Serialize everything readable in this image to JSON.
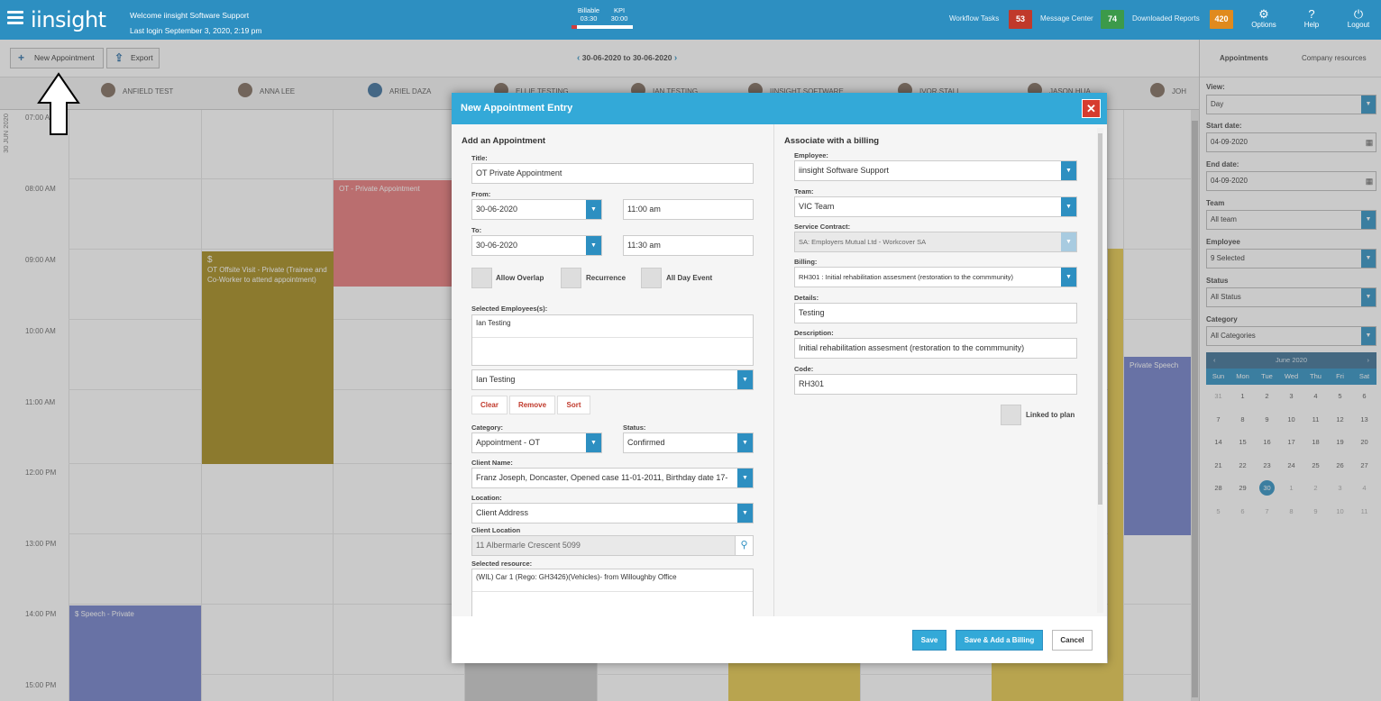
{
  "topbar": {
    "logo": "iinsight",
    "welcome": "Welcome iinsight Software Support",
    "last_login": "Last login September 3, 2020, 2:19 pm",
    "billable_label": "Billable",
    "billable_value": "03:30",
    "kpi_label": "KPI",
    "kpi_value": "30:00",
    "billable_progress": 0.09,
    "workflow_label": "Workflow Tasks",
    "workflow_count": "53",
    "message_label": "Message Center",
    "message_count": "74",
    "reports_label": "Downloaded Reports",
    "reports_count": "420",
    "options_label": "Options",
    "help_label": "Help",
    "logout_label": "Logout",
    "colors": {
      "bar": "#2d8fc1",
      "workflow": "#c0392b",
      "message": "#3c9a4a",
      "reports": "#e08a1e"
    }
  },
  "toolbar": {
    "new_appointment": "New Appointment",
    "export": "Export",
    "date_range": "30-06-2020 to 30-06-2020"
  },
  "calendar": {
    "day_label": "30 JUN 2020",
    "employees": [
      "ANFIELD TEST",
      "ANNA LEE",
      "ARIEL DAZA",
      "ELLIE TESTING",
      "IAN TESTING",
      "IINSIGHT SOFTWARE",
      "IVOR STALL",
      "JASON HUA",
      "JOH"
    ],
    "times": [
      "07:00 AM",
      "08:00 AM",
      "09:00 AM",
      "10:00 AM",
      "11:00 AM",
      "12:00 PM",
      "13:00 PM",
      "14:00 PM",
      "15:00 PM"
    ],
    "appointments": {
      "ot_private": "OT - Private Appointment",
      "ot_offsite_symbol": "$",
      "ot_offsite": "OT Offsite Visit - Private (Trainee and Co-Worker to attend appointment)",
      "private_speech": "Private Speech",
      "speech_private": "$ Speech - Private"
    }
  },
  "right_panel": {
    "tab_appointments": "Appointments",
    "tab_resources": "Company resources",
    "view_label": "View:",
    "view_value": "Day",
    "start_label": "Start date:",
    "start_value": "04-09-2020",
    "end_label": "End date:",
    "end_value": "04-09-2020",
    "team_label": "Team",
    "team_value": "All team",
    "employee_label": "Employee",
    "employee_value": "9 Selected",
    "status_label": "Status",
    "status_value": "All Status",
    "category_label": "Category",
    "category_value": "All Categories",
    "month": "June 2020",
    "weekdays": [
      "Sun",
      "Mon",
      "Tue",
      "Wed",
      "Thu",
      "Fri",
      "Sat"
    ],
    "weeks": [
      [
        "31",
        "1",
        "2",
        "3",
        "4",
        "5",
        "6"
      ],
      [
        "7",
        "8",
        "9",
        "10",
        "11",
        "12",
        "13"
      ],
      [
        "14",
        "15",
        "16",
        "17",
        "18",
        "19",
        "20"
      ],
      [
        "21",
        "22",
        "23",
        "24",
        "25",
        "26",
        "27"
      ],
      [
        "28",
        "29",
        "30",
        "1",
        "2",
        "3",
        "4"
      ],
      [
        "5",
        "6",
        "7",
        "8",
        "9",
        "10",
        "11"
      ]
    ],
    "selected_day": "30"
  },
  "modal": {
    "title": "New Appointment Entry",
    "left": {
      "section": "Add an Appointment",
      "title_label": "Title:",
      "title_value": "OT Private Appointment",
      "from_label": "From:",
      "from_date": "30-06-2020",
      "from_time": "11:00 am",
      "to_label": "To:",
      "to_date": "30-06-2020",
      "to_time": "11:30 am",
      "allow_overlap": "Allow Overlap",
      "recurrence": "Recurrence",
      "all_day": "All Day Event",
      "selected_employees_label": "Selected Employees(s):",
      "selected_employee": "Ian Testing",
      "employee_select": "Ian Testing",
      "clear": "Clear",
      "remove": "Remove",
      "sort": "Sort",
      "category_label": "Category:",
      "category_value": "Appointment -  OT",
      "status_label": "Status:",
      "status_value": "Confirmed",
      "client_name_label": "Client Name:",
      "client_name_value": "Franz Joseph, Doncaster, Opened case 11-01-2011, Birthday date 17-",
      "location_label": "Location:",
      "location_value": "Client Address",
      "client_location_label": "Client Location",
      "client_location_value": "11 Albermarle Crescent 5099",
      "selected_resource_label": "Selected resource:",
      "selected_resource_value": "(WIL) Car 1 (Rego: GH3426)(Vehicles)- from Willoughby Office"
    },
    "right": {
      "section": "Associate with a billing",
      "employee_label": "Employee:",
      "employee_value": "iinsight Software Support",
      "team_label": "Team:",
      "team_value": "VIC Team",
      "service_label": "Service Contract:",
      "service_value": "SA: Employers Mutual Ltd - Workcover SA",
      "billing_label": "Billing:",
      "billing_value": "RH301 : Initial rehabilitation assesment (restoration to the commmunity)",
      "details_label": "Details:",
      "details_value": "Testing",
      "description_label": "Description:",
      "description_value": "Initial rehabilitation assesment (restoration to the commmunity)",
      "code_label": "Code:",
      "code_value": "RH301",
      "linked_label": "Linked to plan"
    },
    "footer": {
      "save": "Save",
      "save_billing": "Save & Add a Billing",
      "cancel": "Cancel"
    }
  }
}
